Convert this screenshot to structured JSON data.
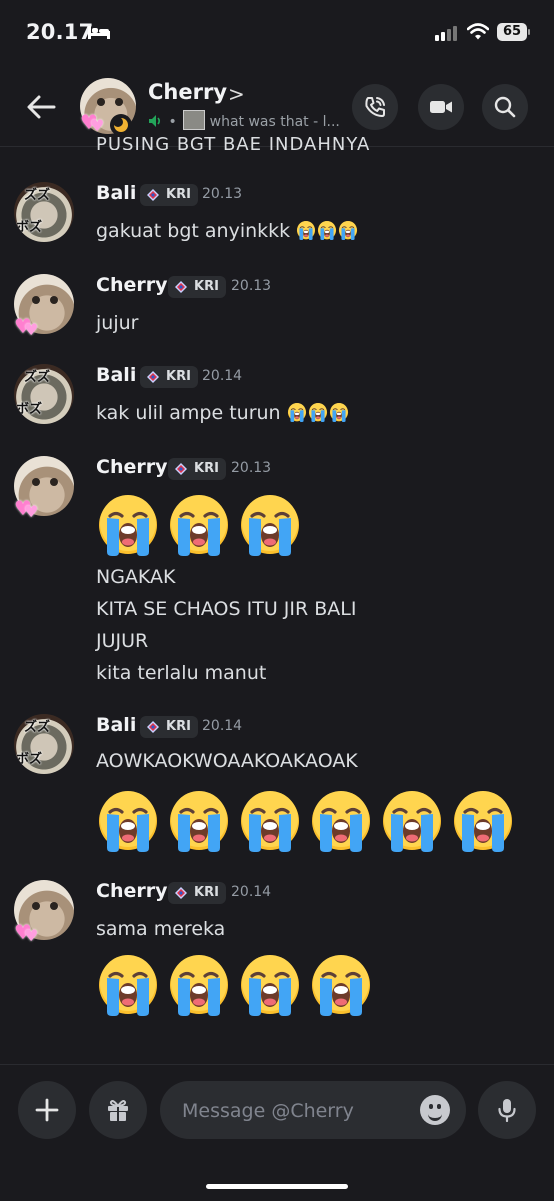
{
  "status_bar": {
    "time": "20.17",
    "battery": "65"
  },
  "header": {
    "name": "Cherry",
    "chevron": ">",
    "activity": "what was that - l..."
  },
  "cut_off_text": "PUSING BGT BAE INDAHNYA",
  "messages": [
    {
      "author": "Bali",
      "tag": "KRI",
      "time": "20.13",
      "lines": [
        "gakuat bgt anyinkkk"
      ],
      "inline_cry_emojis": 3,
      "big_cry_emojis": 0,
      "avatar": "bali"
    },
    {
      "author": "Cherry",
      "tag": "KRI",
      "time": "20.13",
      "lines": [
        "jujur"
      ],
      "inline_cry_emojis": 0,
      "big_cry_emojis": 0,
      "avatar": "cherry"
    },
    {
      "author": "Bali",
      "tag": "KRI",
      "time": "20.14",
      "lines": [
        "kak ulil ampe turun"
      ],
      "inline_cry_emojis": 3,
      "big_cry_emojis": 0,
      "avatar": "bali"
    },
    {
      "author": "Cherry",
      "tag": "KRI",
      "time": "20.13",
      "lines": [
        "NGAKAK",
        "KITA SE CHAOS ITU JIR BALI",
        "JUJUR",
        "kita terlalu manut"
      ],
      "inline_cry_emojis": 0,
      "big_cry_emojis": 3,
      "avatar": "cherry"
    },
    {
      "author": "Bali",
      "tag": "KRI",
      "time": "20.14",
      "lines": [
        "AOWKAOKWOAAKOAKAOAK"
      ],
      "inline_cry_emojis": 0,
      "big_cry_emojis": 6,
      "avatar": "bali"
    },
    {
      "author": "Cherry",
      "tag": "KRI",
      "time": "20.14",
      "lines": [
        "sama mereka"
      ],
      "inline_cry_emojis": 0,
      "big_cry_emojis": 4,
      "avatar": "cherry"
    }
  ],
  "composer": {
    "placeholder": "Message @Cherry"
  },
  "icons": {
    "back": "arrow-left-icon",
    "call": "phone-icon",
    "video": "video-camera-icon",
    "search": "search-icon",
    "add": "plus-icon",
    "gift": "gift-icon",
    "emoji": "smile-icon",
    "voice": "microphone-icon",
    "emoji_in_text": "loudly-crying-face"
  },
  "colors": {
    "background": "#1a1a1e",
    "button_bg": "#2b2d31",
    "text": "#dbdee1",
    "muted": "#949ba4",
    "voice_green": "#23a55a"
  }
}
